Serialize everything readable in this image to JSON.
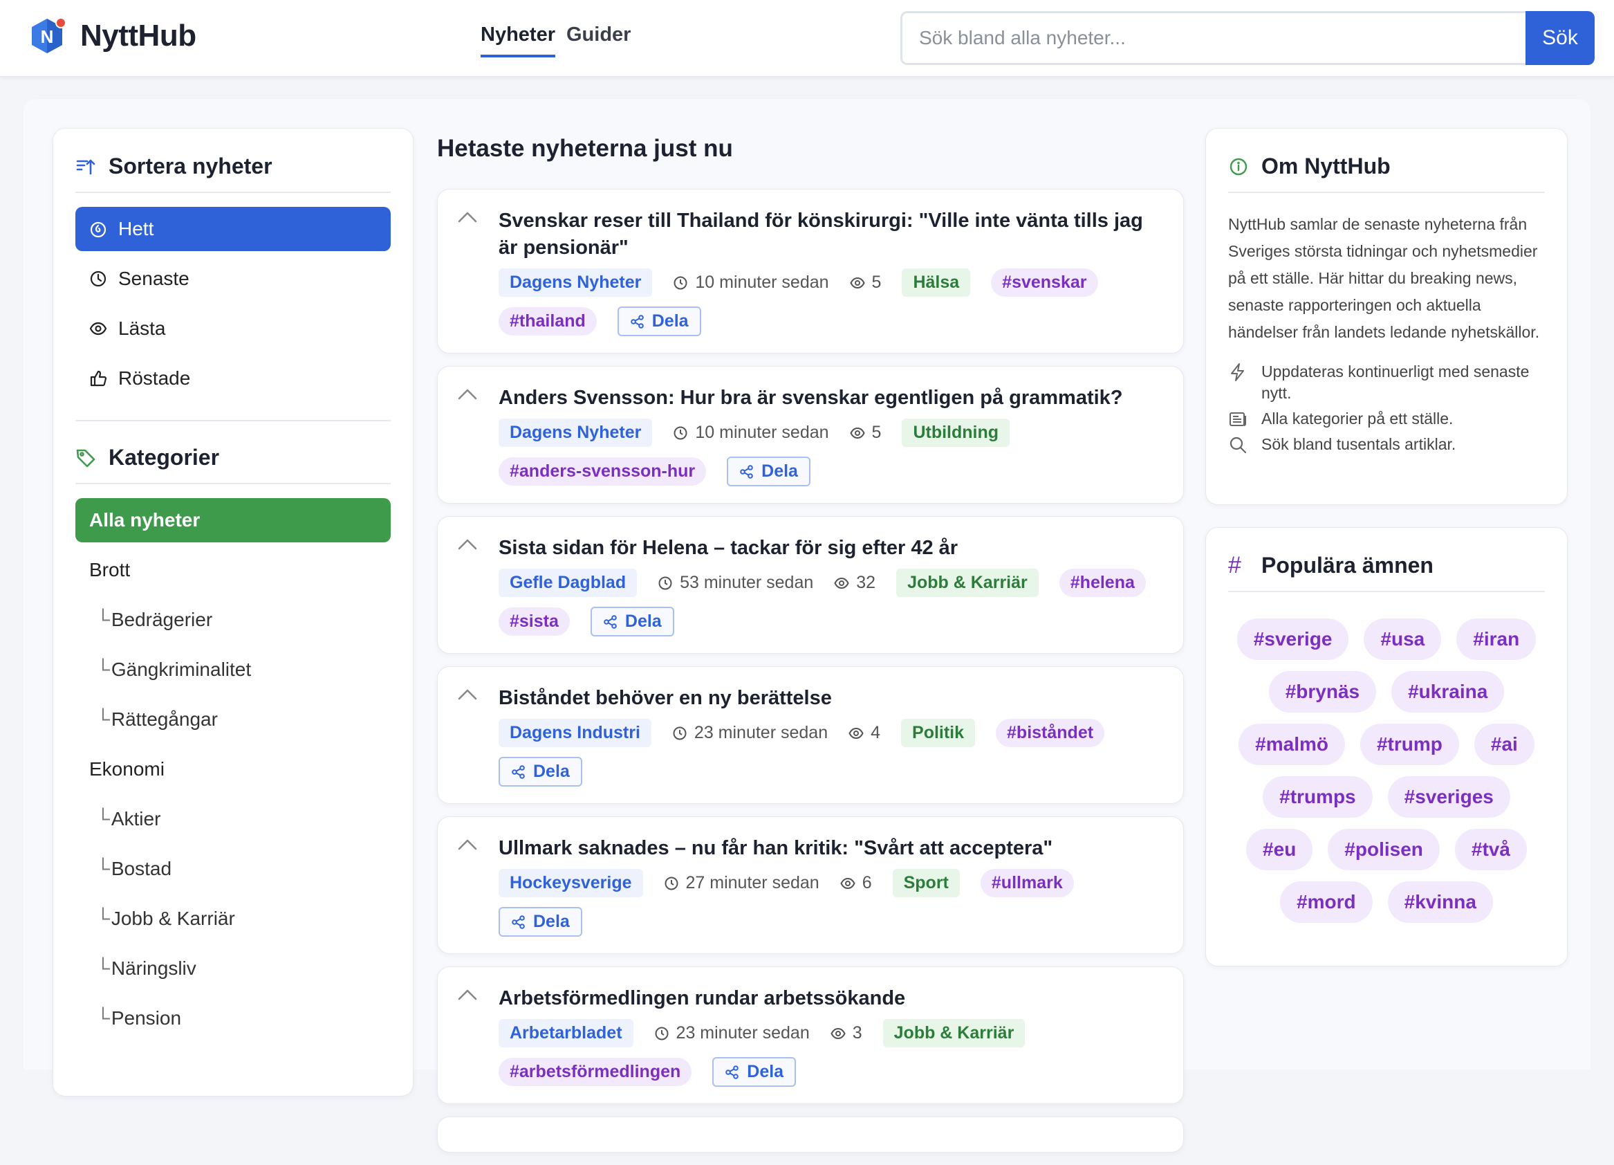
{
  "app": {
    "name": "NyttHub",
    "logo_letter": "N"
  },
  "nav": {
    "items": [
      {
        "label": "Nyheter",
        "active": true
      },
      {
        "label": "Guider",
        "active": false
      }
    ]
  },
  "search": {
    "placeholder": "Sök bland alla nyheter...",
    "value": "",
    "button": "Sök"
  },
  "sidebar": {
    "sort_title": "Sortera nyheter",
    "sort_items": [
      {
        "label": "Hett",
        "icon": "flame-icon",
        "active": true
      },
      {
        "label": "Senaste",
        "icon": "clock-icon",
        "active": false
      },
      {
        "label": "Lästa",
        "icon": "eye-icon",
        "active": false
      },
      {
        "label": "Röstade",
        "icon": "thumbs-up-icon",
        "active": false
      }
    ],
    "cat_title": "Kategorier",
    "categories": [
      {
        "label": "Alla nyheter",
        "level": 0,
        "active": true
      },
      {
        "label": "Brott",
        "level": 0
      },
      {
        "label": "Bedrägerier",
        "level": 1
      },
      {
        "label": "Gängkriminalitet",
        "level": 1
      },
      {
        "label": "Rättegångar",
        "level": 1
      },
      {
        "label": "Ekonomi",
        "level": 0
      },
      {
        "label": "Aktier",
        "level": 1
      },
      {
        "label": "Bostad",
        "level": 1
      },
      {
        "label": "Jobb & Karriär",
        "level": 1
      },
      {
        "label": "Näringsliv",
        "level": 1
      },
      {
        "label": "Pension",
        "level": 1
      }
    ],
    "branch_glyph": "└"
  },
  "feed": {
    "title": "Hetaste nyheterna just nu",
    "share_label": "Dela",
    "items": [
      {
        "title": "Svenskar reser till Thailand för könskirurgi: \"Ville inte vänta tills jag är pensionär\"",
        "source": "Dagens Nyheter",
        "time": "10 minuter sedan",
        "views": "5",
        "category": "Hälsa",
        "tags": [
          "#svenskar",
          "#thailand"
        ]
      },
      {
        "title": "Anders Svensson: Hur bra är svenskar egentligen på grammatik?",
        "source": "Dagens Nyheter",
        "time": "10 minuter sedan",
        "views": "5",
        "category": "Utbildning",
        "tags": [
          "#anders-svensson-hur"
        ]
      },
      {
        "title": "Sista sidan för Helena – tackar för sig efter 42 år",
        "source": "Gefle Dagblad",
        "time": "53 minuter sedan",
        "views": "32",
        "category": "Jobb & Karriär",
        "tags": [
          "#helena",
          "#sista"
        ]
      },
      {
        "title": "Biståndet behöver en ny berättelse",
        "source": "Dagens Industri",
        "time": "23 minuter sedan",
        "views": "4",
        "category": "Politik",
        "tags": [
          "#biståndet"
        ]
      },
      {
        "title": "Ullmark saknades – nu får han kritik: \"Svårt att acceptera\"",
        "source": "Hockeysverige",
        "time": "27 minuter sedan",
        "views": "6",
        "category": "Sport",
        "tags": [
          "#ullmark"
        ]
      },
      {
        "title": "Arbetsförmedlingen rundar arbetssökande",
        "source": "Arbetarbladet",
        "time": "23 minuter sedan",
        "views": "3",
        "category": "Jobb & Karriär",
        "tags": [
          "#arbetsförmedlingen"
        ]
      }
    ]
  },
  "about": {
    "title": "Om NyttHub",
    "text": "NyttHub samlar de senaste nyheterna från Sveriges största tidningar och nyhetsmedier på ett ställe. Här hittar du breaking news, senaste rapporteringen och aktuella händelser från landets ledande nyhetskällor.",
    "features": [
      {
        "icon": "lightning-icon",
        "text": "Uppdateras kontinuerligt med senaste nytt."
      },
      {
        "icon": "newspaper-icon",
        "text": "Alla kategorier på ett ställe."
      },
      {
        "icon": "search-icon",
        "text": "Sök bland tusentals artiklar."
      }
    ]
  },
  "popular": {
    "title": "Populära ämnen",
    "title_icon": "#",
    "tags": [
      "#sverige",
      "#usa",
      "#iran",
      "#brynäs",
      "#ukraina",
      "#malmö",
      "#trump",
      "#ai",
      "#trumps",
      "#sveriges",
      "#eu",
      "#polisen",
      "#två",
      "#mord",
      "#kvinna"
    ]
  },
  "colors": {
    "primary": "#2f62d9",
    "green": "#3f9b4c",
    "purple": "#7b2fbf",
    "logo_red": "#e84c3d"
  }
}
